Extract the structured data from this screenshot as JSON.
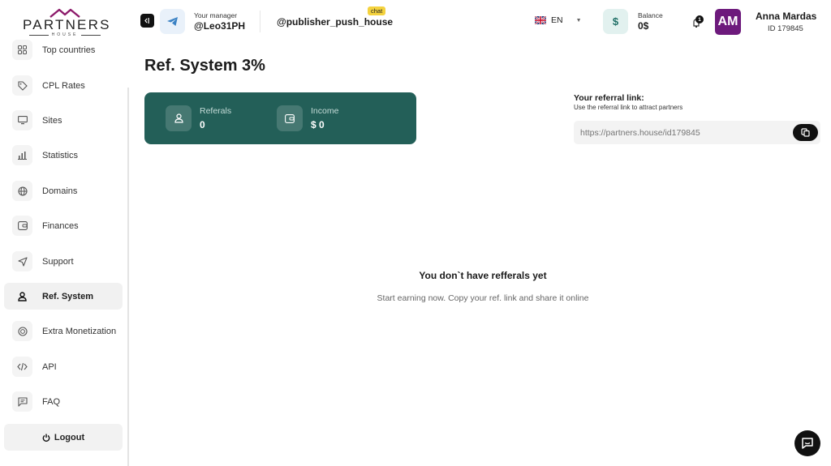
{
  "brand": {
    "name": "PARTNERS",
    "sub": "HOUSE",
    "roof_color": "#8c1a6a"
  },
  "header": {
    "manager_label": "Your manager",
    "manager_name": "@Leo31PH",
    "chat_badge": "chat",
    "publisher": "@publisher_push_house",
    "language": "EN",
    "balance_label": "Balance",
    "balance_value": "0$",
    "balance_icon": "$",
    "notifications_count": "1",
    "avatar_initials": "AM",
    "user_name": "Anna Mardas",
    "user_id": "ID 179845"
  },
  "sidebar": {
    "items": [
      {
        "label": "Top countries",
        "icon": "grid-icon"
      },
      {
        "label": "CPL Rates",
        "icon": "tag-icon"
      },
      {
        "label": "Sites",
        "icon": "monitor-icon"
      },
      {
        "label": "Statistics",
        "icon": "bar-chart-icon"
      },
      {
        "label": "Domains",
        "icon": "globe-icon"
      },
      {
        "label": "Finances",
        "icon": "wallet-icon"
      },
      {
        "label": "Support",
        "icon": "send-icon"
      },
      {
        "label": "Ref. System",
        "icon": "user-icon",
        "active": true
      },
      {
        "label": "Extra Monetization",
        "icon": "coin-icon"
      },
      {
        "label": "API",
        "icon": "code-icon"
      },
      {
        "label": "FAQ",
        "icon": "message-icon"
      }
    ],
    "logout_label": "Logout"
  },
  "main": {
    "title": "Ref. System 3%",
    "stats": {
      "referrals_label": "Referals",
      "referrals_value": "0",
      "income_label": "Income",
      "income_value": "$ 0"
    },
    "referral": {
      "title": "Your referral link:",
      "subtitle": "Use the referral link to attract partners",
      "link": "https://partners.house/id179845"
    },
    "empty": {
      "title": "You don`t have refferals yet",
      "subtitle": "Start earning now. Copy your ref. link and share it online"
    }
  },
  "colors": {
    "accent": "#235f58",
    "avatar": "#6d1a7c",
    "chat_badge": "#f4d23e"
  }
}
